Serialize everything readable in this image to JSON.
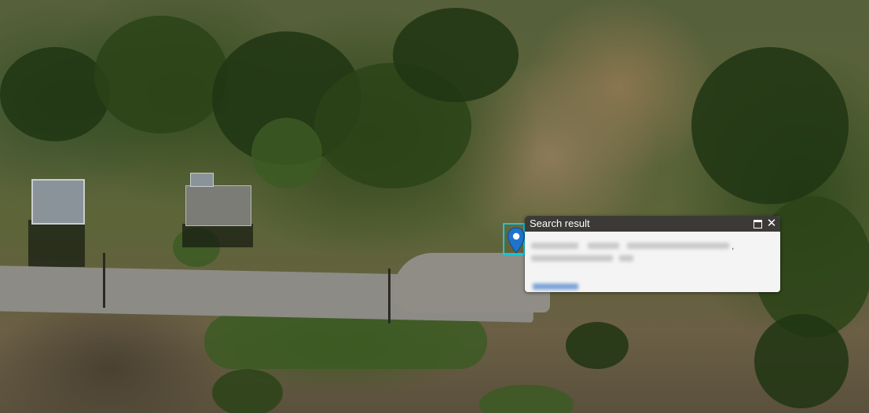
{
  "map": {
    "type": "satellite",
    "marker_icon": "map-pin-icon",
    "colors": {
      "selection_outline": "#19c7d6",
      "marker": "#1f73c9",
      "popup_header": "#3c3a37"
    }
  },
  "popup": {
    "title": "Search result",
    "maximize_icon": "maximize-icon",
    "close_icon": "close-icon",
    "close_label": "✕",
    "address_text": "",
    "link_text": ""
  }
}
